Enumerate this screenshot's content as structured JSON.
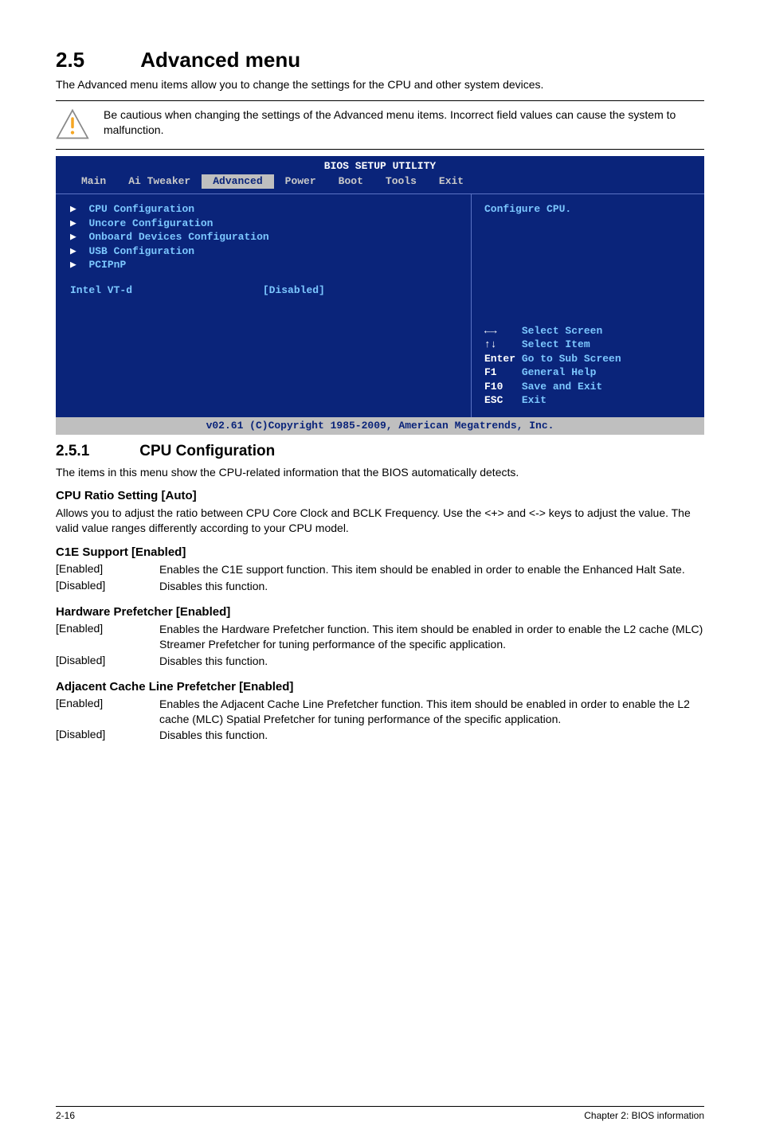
{
  "heading": {
    "num": "2.5",
    "title": "Advanced menu"
  },
  "intro": "The Advanced menu items allow you to change the settings for the CPU and other system devices.",
  "caution": "Be cautious when changing the settings of the Advanced menu items. Incorrect field values can cause the system to malfunction.",
  "bios": {
    "title": "BIOS SETUP UTILITY",
    "tabs": [
      "Main",
      "Ai Tweaker",
      "Advanced",
      "Power",
      "Boot",
      "Tools",
      "Exit"
    ],
    "active_tab": "Advanced",
    "menu": [
      "CPU Configuration",
      "Uncore Configuration",
      "Onboard Devices Configuration",
      "USB Configuration",
      "PCIPnP"
    ],
    "setting_label": "Intel VT-d",
    "setting_value": "[Disabled]",
    "help_top": "Configure CPU.",
    "keys": [
      {
        "k": "←→",
        "d": "Select Screen"
      },
      {
        "k": "↑↓",
        "d": "Select Item"
      },
      {
        "k": "Enter",
        "d": "Go to Sub Screen"
      },
      {
        "k": "F1",
        "d": "General Help"
      },
      {
        "k": "F10",
        "d": "Save and Exit"
      },
      {
        "k": "ESC",
        "d": "Exit"
      }
    ],
    "footer": "v02.61 (C)Copyright 1985-2009, American Megatrends, Inc."
  },
  "sub": {
    "num": "2.5.1",
    "title": "CPU Configuration"
  },
  "sub_intro": "The items in this menu show the CPU-related information that the BIOS automatically detects.",
  "cpu_ratio": {
    "title": "CPU Ratio Setting [Auto]",
    "text": "Allows you to adjust the ratio between CPU Core Clock and BCLK Frequency. Use the <+> and <-> keys to adjust the value. The valid value ranges differently according to your CPU model."
  },
  "c1e": {
    "title": "C1E Support [Enabled]",
    "opts": [
      {
        "label": "[Enabled]",
        "desc": "Enables the C1E support function. This item should be enabled in order to enable the Enhanced Halt Sate."
      },
      {
        "label": "[Disabled]",
        "desc": "Disables this function."
      }
    ]
  },
  "hw_prefetch": {
    "title": "Hardware Prefetcher [Enabled]",
    "opts": [
      {
        "label": "[Enabled]",
        "desc": "Enables the Hardware Prefetcher function. This item should be enabled in order to enable the L2 cache (MLC) Streamer Prefetcher for tuning performance of the specific application."
      },
      {
        "label": "[Disabled]",
        "desc": "Disables this function."
      }
    ]
  },
  "adj_cache": {
    "title": "Adjacent Cache Line Prefetcher [Enabled]",
    "opts": [
      {
        "label": "[Enabled]",
        "desc": "Enables the Adjacent Cache Line Prefetcher function. This item should be enabled in order to enable the L2 cache (MLC) Spatial Prefetcher for tuning performance of the specific application."
      },
      {
        "label": "[Disabled]",
        "desc": "Disables this function."
      }
    ]
  },
  "footer": {
    "left": "2-16",
    "right": "Chapter 2: BIOS information"
  }
}
